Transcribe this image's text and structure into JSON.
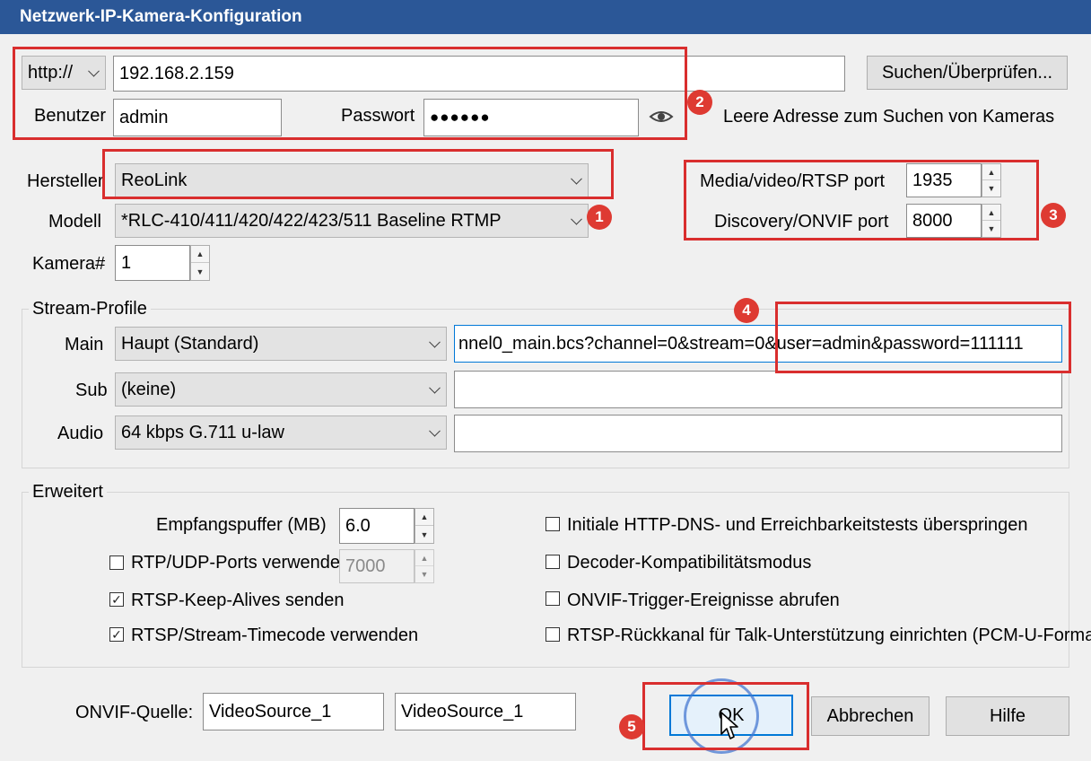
{
  "window": {
    "title": "Netzwerk-IP-Kamera-Konfiguration"
  },
  "connection": {
    "protocol": "http://",
    "address": "192.168.2.159",
    "search_button": "Suchen/Überprüfen...",
    "user_label": "Benutzer",
    "user_value": "admin",
    "password_label": "Passwort",
    "password_value": "●●●●●●",
    "empty_address_hint": "Leere Adresse zum Suchen von Kameras"
  },
  "device": {
    "manufacturer_label": "Hersteller",
    "manufacturer_value": "ReoLink",
    "model_label": "Modell",
    "model_value": "*RLC-410/411/420/422/423/511 Baseline RTMP",
    "camera_label": "Kamera#",
    "camera_value": "1"
  },
  "ports": {
    "rtsp_label": "Media/video/RTSP port",
    "rtsp_value": "1935",
    "onvif_label": "Discovery/ONVIF port",
    "onvif_value": "8000"
  },
  "streams": {
    "title": "Stream-Profile",
    "main_label": "Main",
    "main_value": "Haupt (Standard)",
    "main_url": "nnel0_main.bcs?channel=0&stream=0&user=admin&password=111111",
    "sub_label": "Sub",
    "sub_value": "(keine)",
    "sub_url": "",
    "audio_label": "Audio",
    "audio_value": "64 kbps G.711 u-law",
    "audio_url": ""
  },
  "advanced": {
    "title": "Erweitert",
    "buffer_label": "Empfangspuffer (MB)",
    "buffer_value": "6.0",
    "rtp_udp_label": "RTP/UDP-Ports verwenden:",
    "rtp_udp_value": "7000",
    "rtp_udp_checked": false,
    "keepalive_label": "RTSP-Keep-Alives senden",
    "keepalive_checked": true,
    "timecode_label": "RTSP/Stream-Timecode verwenden",
    "timecode_checked": true,
    "skip_dns_label": "Initiale HTTP-DNS- und Erreichbarkeitstests überspringen",
    "decoder_label": "Decoder-Kompatibilitätsmodus",
    "onvif_events_label": "ONVIF-Trigger-Ereignisse abrufen",
    "backchannel_label": "RTSP-Rückkanal für Talk-Unterstützung einrichten (PCM-U-Format)"
  },
  "onvif_source": {
    "label": "ONVIF-Quelle:",
    "value1": "VideoSource_1",
    "value2": "VideoSource_1"
  },
  "buttons": {
    "ok": "OK",
    "cancel": "Abbrechen",
    "help": "Hilfe"
  },
  "badges": [
    "1",
    "2",
    "3",
    "4",
    "5"
  ],
  "colors": {
    "titlebar": "#2b5797",
    "highlight": "#d92e2e",
    "badge": "#de3a32"
  }
}
